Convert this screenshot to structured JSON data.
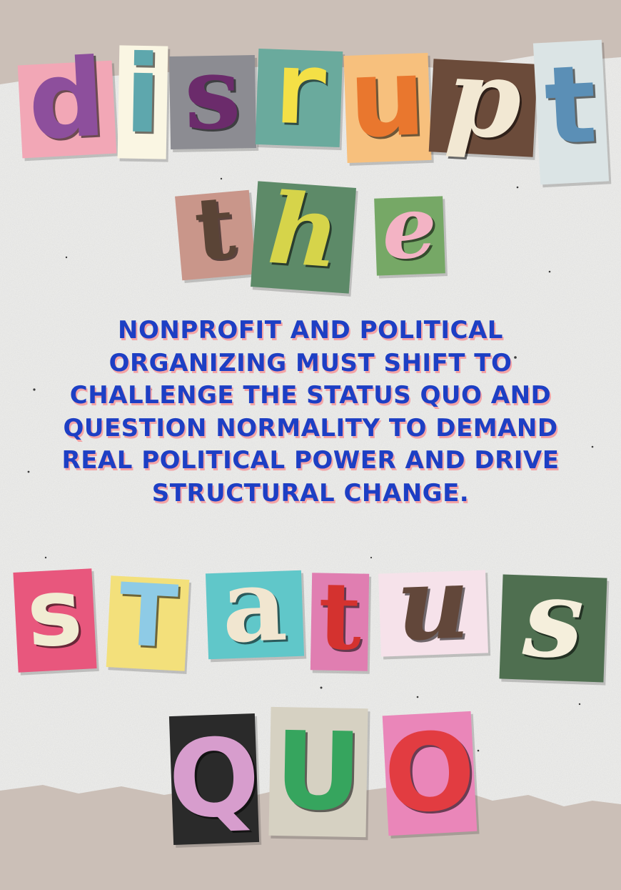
{
  "poster": {
    "background_color": "#cbbfb7",
    "paper_color": "#efefed",
    "headline": {
      "line1": {
        "text": "disrupt",
        "letters": [
          {
            "char": "d",
            "tile": "#f2a7b6",
            "ink": "#8d4f9c"
          },
          {
            "char": "i",
            "tile": "#faf6e3",
            "ink": "#5ea7ad"
          },
          {
            "char": "s",
            "tile": "#8c8c92",
            "ink": "#6b2b6b"
          },
          {
            "char": "r",
            "tile": "#6aaa9d",
            "ink": "#f4e046"
          },
          {
            "char": "u",
            "tile": "#f7c07d",
            "ink": "#e9772e"
          },
          {
            "char": "p",
            "tile": "#6b4b3a",
            "ink": "#f2e8d3"
          },
          {
            "char": "t",
            "tile": "#dbe4e5",
            "ink": "#5b8fb6"
          }
        ]
      },
      "line2": {
        "text": "the",
        "letters": [
          {
            "char": "t",
            "tile": "#c9968a",
            "ink": "#5a4436"
          },
          {
            "char": "h",
            "tile": "#5d8a68",
            "ink": "#d6d44a"
          },
          {
            "char": "e",
            "tile": "#76a866",
            "ink": "#f3b3c4"
          }
        ]
      },
      "line3": {
        "text": "status",
        "letters": [
          {
            "char": "s",
            "tile": "#e8577d",
            "ink": "#f1ecd3"
          },
          {
            "char": "t",
            "tile": "#f3e07b",
            "ink": "#8ecbe6"
          },
          {
            "char": "a",
            "tile": "#60c7c9",
            "ink": "#f1e6d0"
          },
          {
            "char": "t",
            "tile": "#e07eb1",
            "ink": "#d4322f"
          },
          {
            "char": "u",
            "tile": "#f6e2ea",
            "ink": "#62473a"
          },
          {
            "char": "s",
            "tile": "#4f6f50",
            "ink": "#f5efdc"
          }
        ]
      },
      "line4": {
        "text": "quo",
        "letters": [
          {
            "char": "Q",
            "tile": "#2a2a2a",
            "ink": "#d79dcd"
          },
          {
            "char": "U",
            "tile": "#d6d1c2",
            "ink": "#36a55e"
          },
          {
            "char": "O",
            "tile": "#ea86b9",
            "ink": "#e23c41"
          }
        ]
      }
    },
    "blurb": "NONPROFIT AND POLITICAL ORGANIZING MUST SHIFT TO CHALLENGE THE STATUS QUO AND QUESTION NORMALITY TO DEMAND REAL POLITICAL POWER AND DRIVE STRUCTURAL CHANGE.",
    "blurb_color": "#1d3fc4",
    "blurb_shadow_color": "#f3a3a6"
  }
}
